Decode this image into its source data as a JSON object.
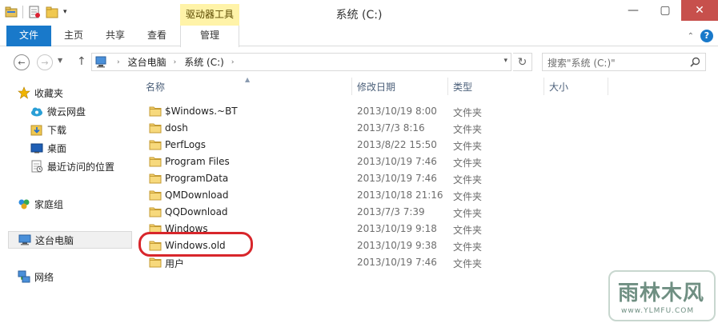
{
  "window": {
    "title": "系统 (C:)",
    "context_tab_group": "驱动器工具"
  },
  "ribbon": {
    "tabs": [
      {
        "label": "文件"
      },
      {
        "label": "主页"
      },
      {
        "label": "共享"
      },
      {
        "label": "查看"
      },
      {
        "label": "管理"
      }
    ]
  },
  "address": {
    "crumbs": [
      "这台电脑",
      "系统 (C:)"
    ],
    "search_placeholder": "搜索\"系统 (C:)\""
  },
  "navpane": {
    "favorites": "收藏夹",
    "favorites_items": [
      "微云网盘",
      "下载",
      "桌面",
      "最近访问的位置"
    ],
    "homegroup": "家庭组",
    "this_pc": "这台电脑",
    "network": "网络"
  },
  "columns": {
    "name": "名称",
    "date": "修改日期",
    "type": "类型",
    "size": "大小"
  },
  "files": [
    {
      "name": "$Windows.~BT",
      "date": "2013/10/19 8:00",
      "type": "文件夹"
    },
    {
      "name": "dosh",
      "date": "2013/7/3 8:16",
      "type": "文件夹"
    },
    {
      "name": "PerfLogs",
      "date": "2013/8/22 15:50",
      "type": "文件夹"
    },
    {
      "name": "Program Files",
      "date": "2013/10/19 7:46",
      "type": "文件夹"
    },
    {
      "name": "ProgramData",
      "date": "2013/10/19 7:46",
      "type": "文件夹"
    },
    {
      "name": "QMDownload",
      "date": "2013/10/18 21:16",
      "type": "文件夹"
    },
    {
      "name": "QQDownload",
      "date": "2013/7/3 7:39",
      "type": "文件夹"
    },
    {
      "name": "Windows",
      "date": "2013/10/19 9:18",
      "type": "文件夹"
    },
    {
      "name": "Windows.old",
      "date": "2013/10/19 9:38",
      "type": "文件夹"
    },
    {
      "name": "用户",
      "date": "2013/10/19 7:46",
      "type": "文件夹"
    }
  ],
  "watermark": {
    "main": "雨林木风",
    "sub": "www.YLMFU.COM"
  },
  "colors": {
    "accent": "#1979ca",
    "close": "#c7504c",
    "context_tab": "#fff3a8",
    "highlight": "#d8262b"
  }
}
